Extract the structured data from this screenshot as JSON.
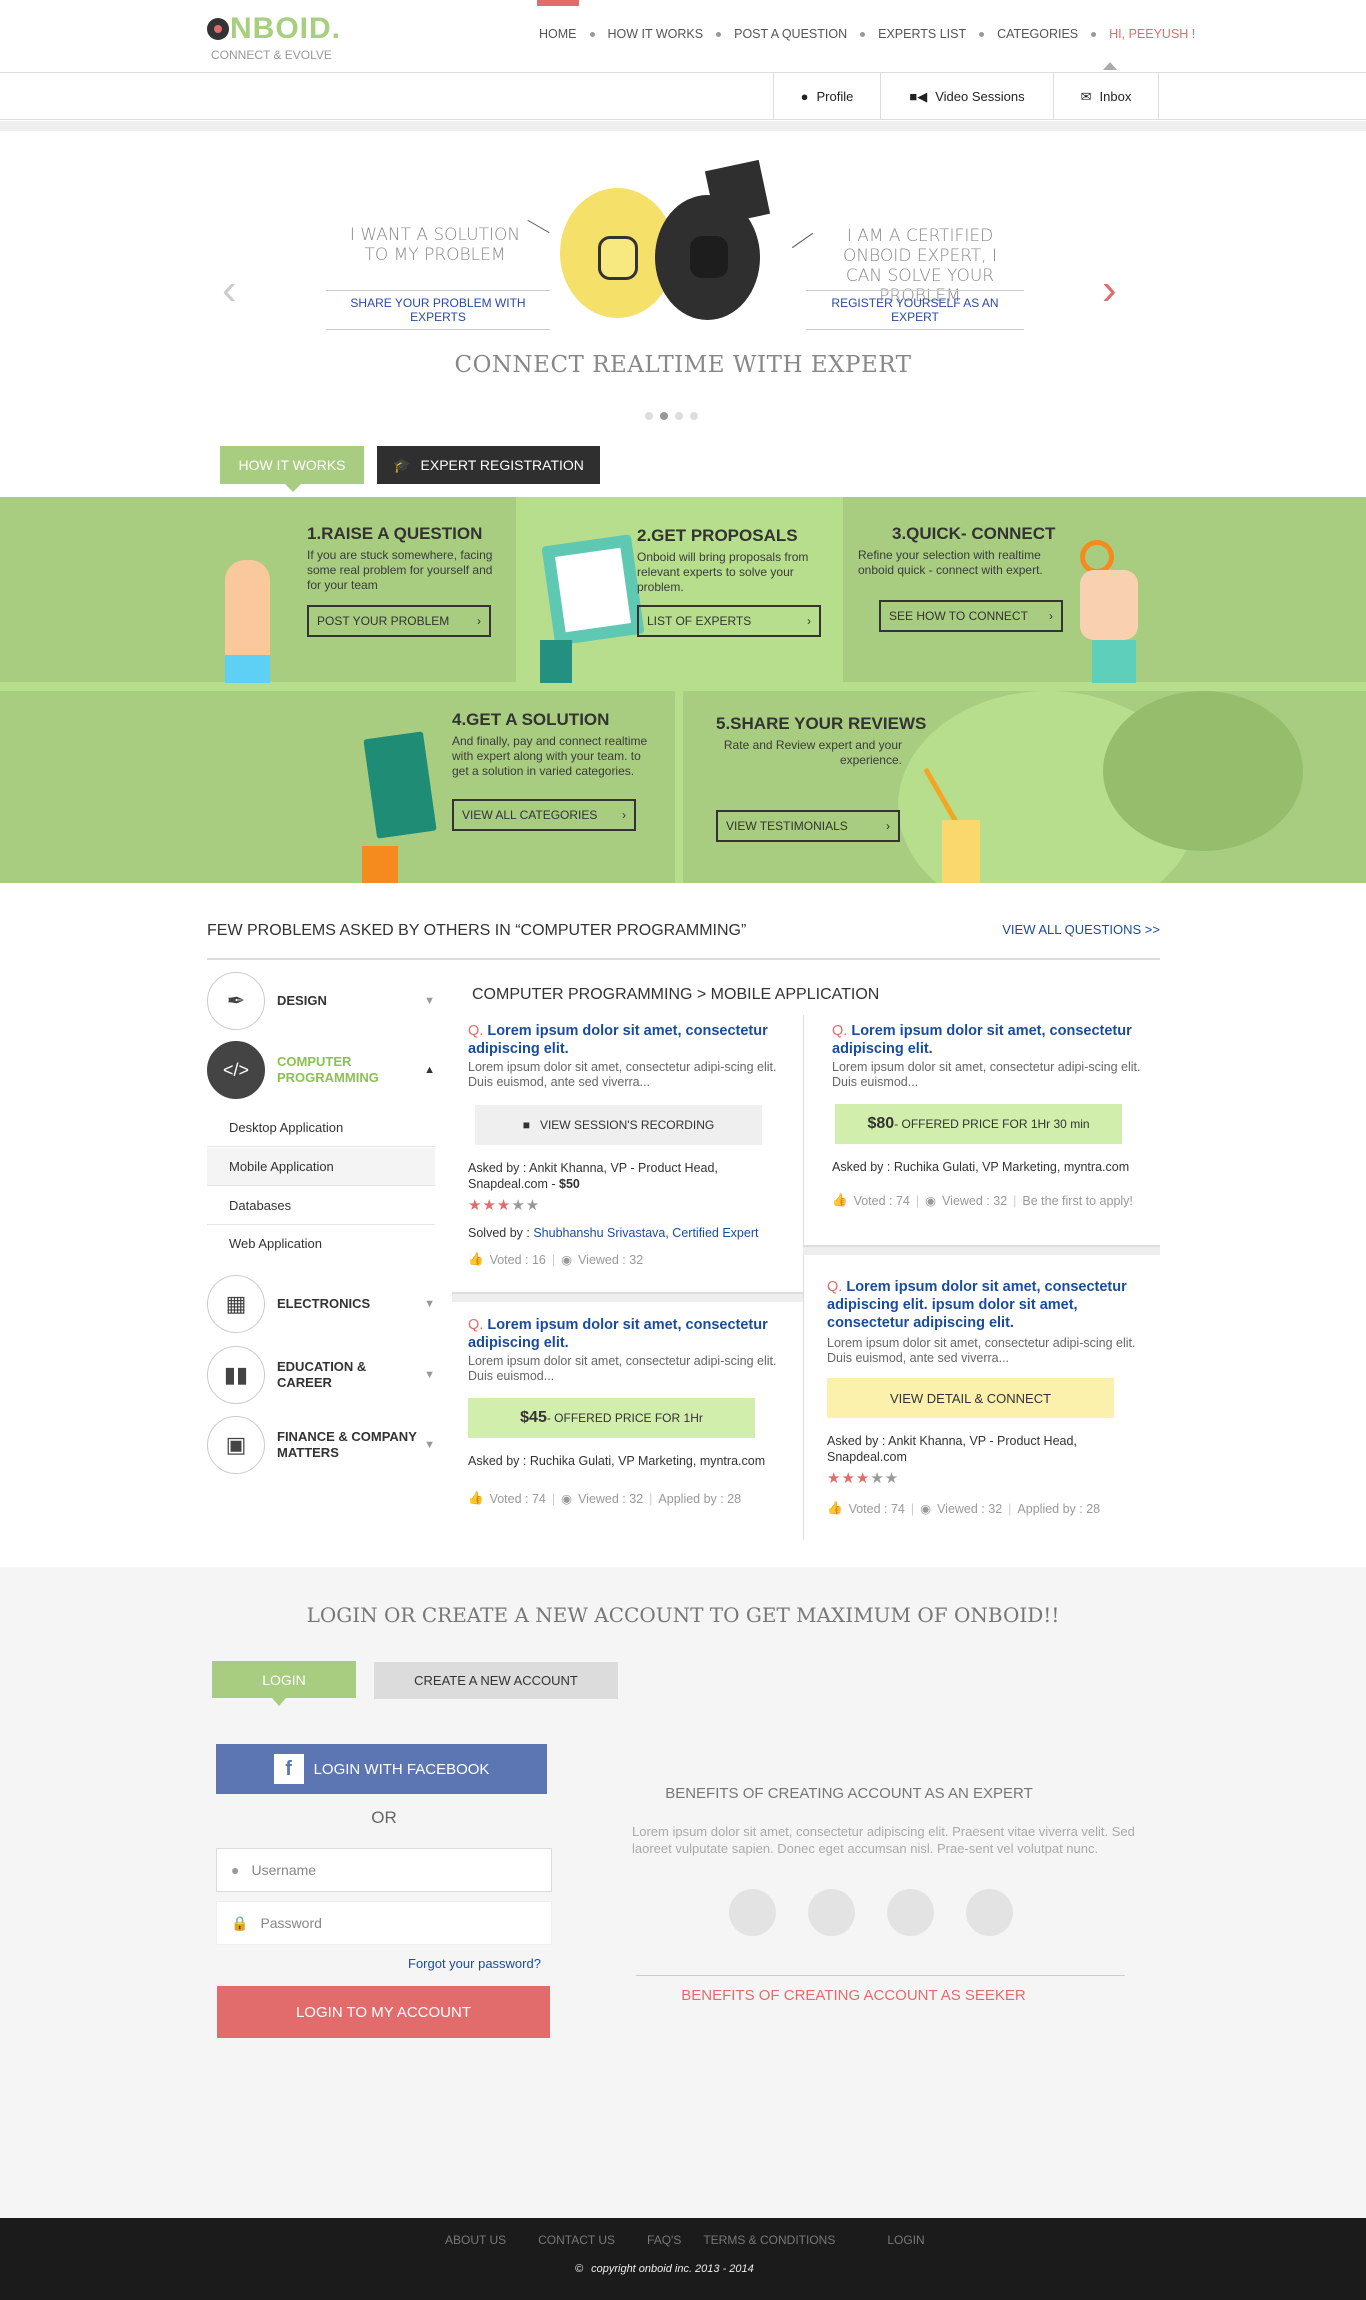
{
  "header": {
    "logo": "NBOID.",
    "logo_letter": "O",
    "tagline": "CONNECT & EVOLVE",
    "nav": [
      "HOME",
      "HOW IT WORKS",
      "POST A QUESTION",
      "EXPERTS LIST",
      "CATEGORIES"
    ],
    "user": "HI, PEEYUSH !",
    "subtabs": [
      "Profile",
      "Video Sessions",
      "Inbox"
    ]
  },
  "hero": {
    "left_text": "I WANT A SOLUTION TO MY PROBLEM",
    "left_link": "SHARE YOUR PROBLEM WITH EXPERTS",
    "right_text": "I AM A CERTIFIED ONBOID EXPERT, I CAN SOLVE YOUR PROBLEM",
    "right_link": "REGISTER YOURSELF AS AN EXPERT",
    "title": "CONNECT REALTIME  WITH EXPERT",
    "slide_count": 4,
    "active_slide": 2
  },
  "tabs": {
    "how": "HOW IT WORKS",
    "expert": "EXPERT REGISTRATION"
  },
  "steps": [
    {
      "title": "1.RAISE A QUESTION",
      "text": "If you are stuck somewhere, facing some real problem for yourself and for your team",
      "button": "POST YOUR PROBLEM"
    },
    {
      "title": "2.GET PROPOSALS",
      "text": "Onboid will bring proposals from relevant experts to solve your problem.",
      "button": "LIST OF EXPERTS"
    },
    {
      "title": "3.QUICK- CONNECT",
      "text": "Refine your selection with realtime onboid quick - connect with expert.",
      "button": "SEE HOW TO CONNECT"
    },
    {
      "title": "4.GET A SOLUTION",
      "text": "And finally, pay and connect realtime with expert along with your team. to get a solution in varied categories.",
      "button": "VIEW ALL CATEGORIES"
    },
    {
      "title": "5.SHARE YOUR REVIEWS",
      "text": "Rate and Review expert and your experience.",
      "button": "VIEW TESTIMONIALS"
    }
  ],
  "questions": {
    "heading": "FEW PROBLEMS ASKED BY OTHERS IN “COMPUTER PROGRAMMING”",
    "view_all": "VIEW ALL QUESTIONS >>",
    "breadcrumb": "COMPUTER PROGRAMMING > MOBILE APPLICATION",
    "categories": [
      "DESIGN",
      "COMPUTER PROGRAMMING",
      "ELECTRONICS",
      "EDUCATION & CAREER",
      "FINANCE & COMPANY MATTERS"
    ],
    "subcategories": [
      "Desktop Application",
      "Mobile Application",
      "Databases",
      "Web Application"
    ],
    "q_prefix": "Q.",
    "cards": [
      {
        "title": "Lorem ipsum dolor sit amet, consectetur adipiscing elit.",
        "desc": "Lorem ipsum dolor sit amet, consectetur adipi-scing elit. Duis euismod, ante sed viverra...",
        "action": "VIEW SESSION'S RECORDING",
        "asked": "Asked by : Ankit Khanna, VP - Product Head, Snapdeal.com  -  ",
        "price": "$50",
        "rating": 3,
        "solved_label": "Solved by : ",
        "solved_by": "Shubhanshu Srivastava, Certified Expert",
        "voted": "Voted : 16",
        "viewed": "Viewed : 32"
      },
      {
        "title": "Lorem ipsum dolor sit amet, consectetur adipiscing elit.",
        "desc": "Lorem ipsum dolor sit amet, consectetur adipi-scing elit. Duis euismod...",
        "price": "$80",
        "price_text": " - OFFERED PRICE FOR 1Hr 30 min",
        "asked": "Asked by : Ruchika Gulati, VP Marketing, myntra.com",
        "voted": "Voted : 74",
        "viewed": "Viewed : 32",
        "applied": "Be the first to apply!"
      },
      {
        "title": "Lorem ipsum dolor sit amet, consectetur adipiscing elit.",
        "desc": "Lorem ipsum dolor sit amet, consectetur adipi-scing elit. Duis euismod...",
        "price": "$45",
        "price_text": " - OFFERED PRICE FOR 1Hr",
        "asked": "Asked by : Ruchika Gulati, VP Marketing, myntra.com",
        "voted": "Voted : 74",
        "viewed": "Viewed : 32",
        "applied": "Applied by : 28"
      },
      {
        "title": "Lorem ipsum dolor sit amet, consectetur adipiscing elit. ipsum dolor sit amet, consectetur adipiscing elit.",
        "desc": "Lorem ipsum dolor sit amet, consectetur adipi-scing elit. Duis euismod, ante sed viverra...",
        "action": "VIEW DETAIL & CONNECT",
        "asked": "Asked by : Ankit Khanna, VP - Product Head, Snapdeal.com",
        "rating": 3,
        "voted": "Voted : 74",
        "viewed": "Viewed : 32",
        "applied": "Applied by : 28"
      }
    ]
  },
  "login": {
    "heading": "LOGIN OR CREATE A NEW ACCOUNT TO GET MAXIMUM OF ONBOID!!",
    "tab_login": "LOGIN",
    "tab_create": "CREATE A NEW ACCOUNT",
    "facebook": "LOGIN WITH FACEBOOK",
    "or": "OR",
    "username_placeholder": "Username",
    "password_placeholder": "Password",
    "forgot": "Forgot your password?",
    "submit": "LOGIN TO MY ACCOUNT",
    "expert_title": "BENEFITS OF CREATING ACCOUNT AS AN EXPERT",
    "expert_text": "Lorem ipsum dolor sit amet, consectetur adipiscing elit. Praesent vitae viverra velit. Sed laoreet vulputate sapien. Donec eget accumsan nisl. Prae-sent vel volutpat nunc.",
    "seeker_title": "BENEFITS OF CREATING ACCOUNT AS SEEKER"
  },
  "footer": {
    "links": [
      "ABOUT US",
      "CONTACT US",
      "FAQ'S",
      "TERMS & CONDITIONS",
      "LOGIN"
    ],
    "copyright": "copyright onboid inc. 2013 - 2014"
  },
  "colors": {
    "green": "#a8cd80",
    "red": "#e26c6c",
    "blue": "#1a4c9c",
    "facebook": "#5b76b3",
    "dark": "#2f2f2f"
  }
}
